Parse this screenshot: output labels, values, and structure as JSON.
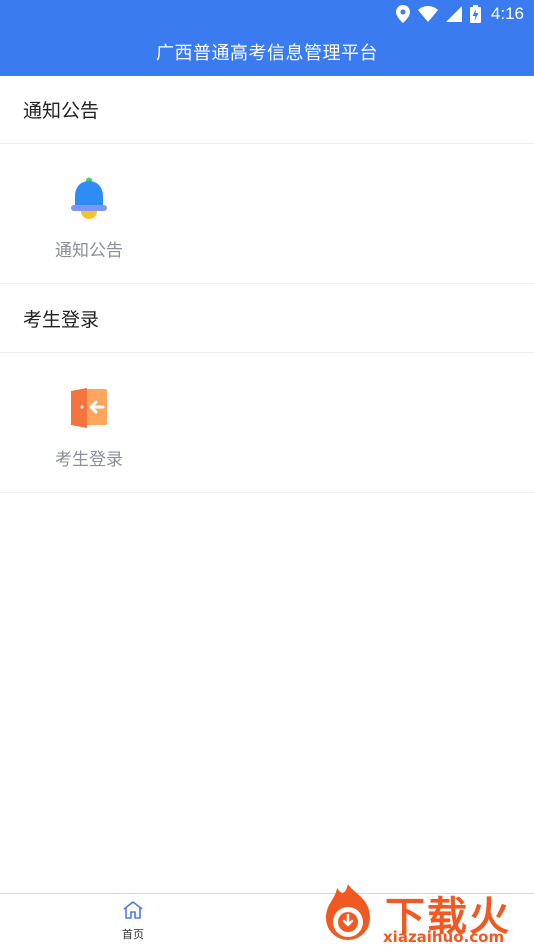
{
  "status_bar": {
    "time": "4:16",
    "icons": [
      "location-icon",
      "wifi-icon",
      "signal-icon",
      "battery-charging-icon"
    ]
  },
  "header": {
    "title": "广西普通高考信息管理平台"
  },
  "sections": [
    {
      "title": "通知公告",
      "tiles": [
        {
          "label": "通知公告",
          "icon": "bell-icon"
        }
      ]
    },
    {
      "title": "考生登录",
      "tiles": [
        {
          "label": "考生登录",
          "icon": "login-door-icon"
        }
      ]
    }
  ],
  "bottom_nav": {
    "items": [
      {
        "label": "首页",
        "icon": "home-icon",
        "active": true
      }
    ]
  },
  "watermark": {
    "logo_text": "下载火",
    "domain": "xiazaihuo.com"
  },
  "colors": {
    "primary": "#3a7cf0",
    "bell_blue": "#2f8cf5",
    "bell_yellow": "#f5c22b",
    "door_orange": "#f5733c",
    "watermark_orange": "#f05a22"
  }
}
